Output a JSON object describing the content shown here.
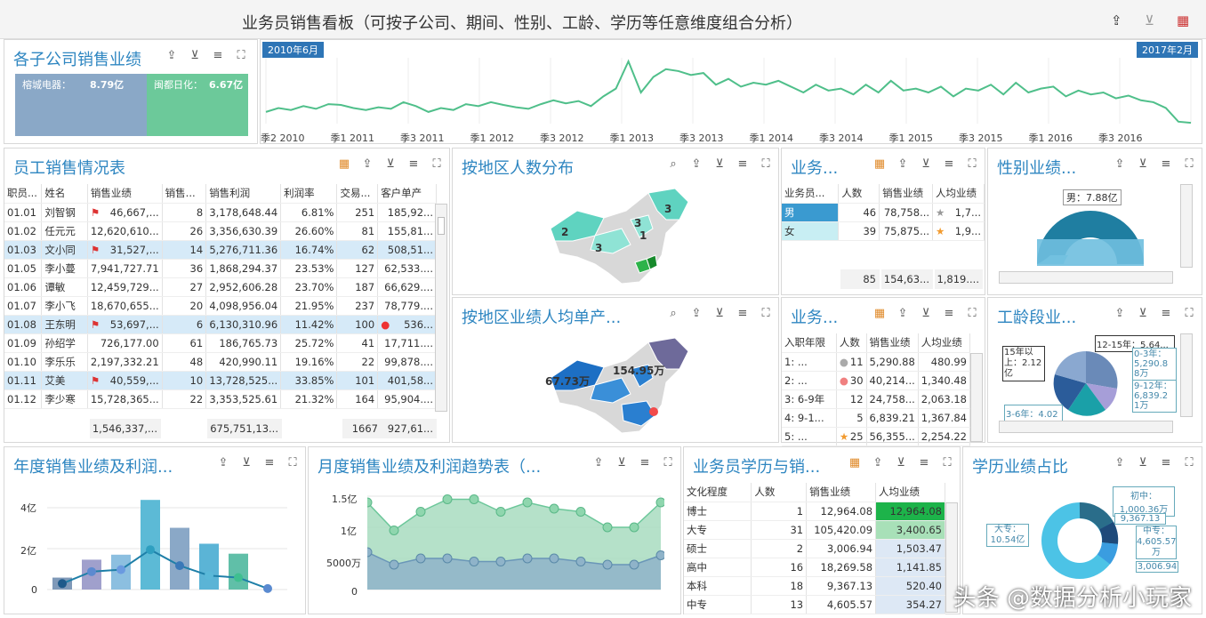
{
  "app": {
    "title": "业务员销售看板（可按子公司、期间、性别、工龄、学历等任意维度组合分析）"
  },
  "sub": {
    "title": "各子公司销售业绩",
    "items": [
      {
        "label": "榕城电器：",
        "value": "8.79亿",
        "color": "#8aa8c7"
      },
      {
        "label": "闽都日化：",
        "value": "6.67亿",
        "color": "#6cc99a"
      }
    ]
  },
  "timeline": {
    "start": "2010年6月",
    "end": "2017年2月",
    "ticks": [
      "季2 2010",
      "季1 2011",
      "季3 2011",
      "季1 2012",
      "季3 2012",
      "季1 2013",
      "季3 2013",
      "季1 2014",
      "季3 2014",
      "季1 2015",
      "季3 2015",
      "季1 2016",
      "季3 2016"
    ],
    "values": [
      30,
      40,
      35,
      45,
      38,
      50,
      48,
      40,
      35,
      42,
      38,
      55,
      45,
      30,
      40,
      35,
      50,
      45,
      55,
      48,
      42,
      38,
      50,
      60,
      52,
      58,
      45,
      70,
      90,
      160,
      80,
      120,
      140,
      135,
      125,
      130,
      100,
      115,
      95,
      105,
      100,
      110,
      95,
      80,
      100,
      85,
      90,
      75,
      100,
      80,
      110,
      85,
      90,
      80,
      95,
      70,
      90,
      85,
      100,
      75,
      105,
      80,
      90,
      95,
      70,
      85,
      75,
      80,
      65,
      72,
      60,
      55,
      40,
      5,
      2
    ]
  },
  "staff": {
    "title": "员工销售情况表",
    "headers": [
      "职员...",
      "姓名",
      "销售业绩",
      "销售...",
      "销售利润",
      "利润率",
      "交易...",
      "客户单产"
    ],
    "rows": [
      [
        "01.01",
        "刘智钢",
        "46,667,...",
        "8",
        "3,178,648.44",
        "6.81%",
        "251",
        "185,92..."
      ],
      [
        "01.02",
        "任元元",
        "12,620,610...",
        "26",
        "3,356,630.39",
        "26.60%",
        "81",
        "155,81..."
      ],
      [
        "01.03",
        "文小同",
        "31,527,...",
        "14",
        "5,276,711.36",
        "16.74%",
        "62",
        "508,51..."
      ],
      [
        "01.05",
        "李小蔓",
        "7,941,727.71",
        "36",
        "1,868,294.37",
        "23.53%",
        "127",
        "62,533...."
      ],
      [
        "01.06",
        "谭敏",
        "12,459,729...",
        "27",
        "2,952,606.28",
        "23.70%",
        "187",
        "66,629...."
      ],
      [
        "01.07",
        "李小飞",
        "18,670,655...",
        "20",
        "4,098,956.04",
        "21.95%",
        "237",
        "78,779...."
      ],
      [
        "01.08",
        "王东明",
        "53,697,...",
        "6",
        "6,130,310.96",
        "11.42%",
        "100",
        "536..."
      ],
      [
        "01.09",
        "孙绍学",
        "726,177.00",
        "61",
        "186,765.73",
        "25.72%",
        "41",
        "17,711...."
      ],
      [
        "01.10",
        "李乐乐",
        "2,197,332.21",
        "48",
        "420,990.11",
        "19.16%",
        "22",
        "99,878...."
      ],
      [
        "01.11",
        "艾美",
        "40,559,...",
        "10",
        "13,728,525...",
        "33.85%",
        "101",
        "401,58..."
      ],
      [
        "01.12",
        "李少寒",
        "15,728,365...",
        "22",
        "3,353,525.61",
        "21.32%",
        "164",
        "95,904...."
      ]
    ],
    "footer": [
      "1,546,337,...",
      "675,751,13...",
      "1667",
      "927,61..."
    ]
  },
  "region": {
    "title": "按地区人数分布",
    "labels": [
      "3",
      "2",
      "3",
      "3",
      "1"
    ]
  },
  "region2": {
    "title": "按地区业绩人均单产...",
    "labels": [
      "154.95万",
      "67.73万"
    ]
  },
  "gender": {
    "title": "业务...",
    "headers": [
      "业务员...",
      "人数",
      "销售业绩",
      "人均业绩"
    ],
    "rows": [
      [
        "男",
        "46",
        "78,758...",
        "1,7..."
      ],
      [
        "女",
        "39",
        "75,875...",
        "1,9..."
      ]
    ],
    "footer": [
      "85",
      "154,63...",
      "1,819...."
    ]
  },
  "gperf": {
    "title": "性别业绩...",
    "label": "男：7.88亿"
  },
  "tenure": {
    "title": "业务...",
    "headers": [
      "入职年限",
      "人数",
      "销售业绩",
      "人均业绩"
    ],
    "rows": [
      [
        "1: ...",
        "11",
        "5,290.88",
        "480.99"
      ],
      [
        "2: ...",
        "30",
        "40,214...",
        "1,340.48"
      ],
      [
        "3: 6-9年",
        "12",
        "24,758...",
        "2,063.18"
      ],
      [
        "4: 9-1...",
        "5",
        "6,839.21",
        "1,367.84"
      ],
      [
        "5: ...",
        "25",
        "56,355...",
        "2,254.22"
      ]
    ]
  },
  "tperf": {
    "title": "工龄段业...",
    "labels": [
      "15年以上：2.12亿",
      "12-15年：5.64...",
      "0-3年：5,290.8 8万",
      "9-12年：6,839.2 1万",
      "3-6年：4.02"
    ]
  },
  "yearly": {
    "title": "年度销售业绩及利润...",
    "yticks": [
      "4亿",
      "2亿",
      "0"
    ],
    "bars": [
      0.6,
      1.5,
      1.75,
      4.5,
      3.1,
      2.3,
      1.8
    ],
    "line": [
      0.3,
      0.9,
      1.0,
      2.0,
      1.2,
      0.7,
      0.6,
      0.05
    ],
    "colors": [
      "#7f99b8",
      "#a0a0cc",
      "#8cbfe0",
      "#5cbad6",
      "#8aa8c7",
      "#5bb4d6",
      "#60bfa8"
    ]
  },
  "monthly": {
    "title": "月度销售业绩及利润趋势表（...",
    "yticks": [
      "1.5亿",
      "1亿",
      "5000万",
      "0"
    ],
    "s1": [
      1.4,
      0.95,
      1.25,
      1.45,
      1.45,
      1.25,
      1.4,
      1.3,
      1.25,
      1.0,
      1.0,
      1.4
    ],
    "s2": [
      0.6,
      0.4,
      0.5,
      0.5,
      0.45,
      0.45,
      0.5,
      0.5,
      0.45,
      0.4,
      0.4,
      0.55
    ]
  },
  "edu": {
    "title": "业务员学历与销...",
    "headers": [
      "文化程度",
      "人数",
      "销售业绩",
      "人均业绩"
    ],
    "rows": [
      [
        "博士",
        "1",
        "12,964.08",
        "12,964.08"
      ],
      [
        "大专",
        "31",
        "105,420.09",
        "3,400.65"
      ],
      [
        "硕士",
        "2",
        "3,006.94",
        "1,503.47"
      ],
      [
        "高中",
        "16",
        "18,269.58",
        "1,141.85"
      ],
      [
        "本科",
        "18",
        "9,367.13",
        "520.40"
      ],
      [
        "中专",
        "13",
        "4,605.57",
        "354.27"
      ]
    ]
  },
  "eperf": {
    "title": "学历业绩占比",
    "labels": [
      "初中：1,000.36万",
      "9,367.13",
      "大专：10.54亿",
      "中专：4,605.57万",
      "3,006.94"
    ]
  },
  "watermark": "头条 @数据分析小玩家"
}
